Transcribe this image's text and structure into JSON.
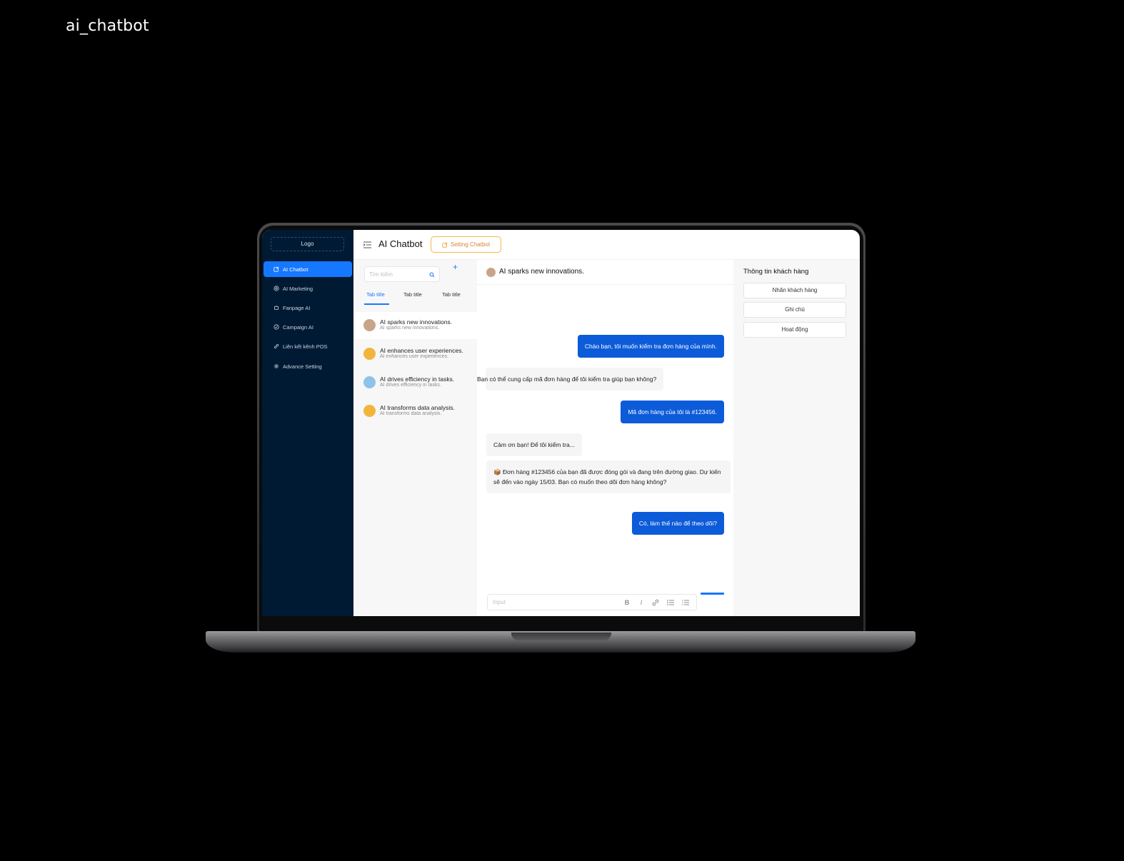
{
  "page_label": "ai_chatbot",
  "sidebar": {
    "logo": "Logo",
    "items": [
      {
        "label": "AI Chatbot",
        "icon": "edit-icon",
        "active": true
      },
      {
        "label": "AI Marketing",
        "icon": "target-icon",
        "active": false
      },
      {
        "label": "Fanpage AI",
        "icon": "puzzle-icon",
        "active": false
      },
      {
        "label": "Campaign AI",
        "icon": "check-circle-icon",
        "active": false
      },
      {
        "label": "Liên kết kênh POS",
        "icon": "link-icon",
        "active": false
      },
      {
        "label": "Advance Setting",
        "icon": "gear-icon",
        "active": false
      }
    ]
  },
  "header": {
    "title": "AI Chatbot",
    "setting_button": "Setting Chatbot"
  },
  "conversations": {
    "search_placeholder": "Tìm kiếm",
    "add_label": "+",
    "tabs": [
      "Tab title",
      "Tab title",
      "Tab title"
    ],
    "items": [
      {
        "title": "AI sparks new innovations.",
        "subtitle": "AI sparks new innovations.",
        "avatar_color": "#c9a48a"
      },
      {
        "title": "AI enhances user experiences.",
        "subtitle": "AI enhances user experiences.",
        "avatar_color": "#f2b53c"
      },
      {
        "title": "AI drives efficiency in tasks.",
        "subtitle": "AI drives efficiency in tasks.",
        "avatar_color": "#8fc2e8"
      },
      {
        "title": "AI transforms data analysis.",
        "subtitle": "AI transforms data analysis.",
        "avatar_color": "#f2b53c"
      }
    ]
  },
  "chat": {
    "title": "AI sparks new innovations.",
    "messages": [
      {
        "side": "out",
        "text": "Chào bạn, tôi muốn kiểm tra đơn hàng của mình."
      },
      {
        "side": "in",
        "text": "Bạn có thể cung cấp mã đơn hàng để tôi kiểm tra giúp bạn không?"
      },
      {
        "side": "out",
        "text": "Mã đơn hàng của tôi là #123456."
      },
      {
        "side": "in",
        "text": "Cảm ơn bạn! Để tôi kiểm tra..."
      },
      {
        "side": "in",
        "text": "📦 Đơn hàng #123456 của bạn đã được đóng gói và đang trên đường giao. Dự kiến sẽ đến vào ngày 15/03. Bạn có muốn theo dõi đơn hàng không?"
      },
      {
        "side": "out",
        "text": "Có, làm thế nào để theo dõi?"
      }
    ],
    "input_placeholder": "Input",
    "format_buttons": [
      "B",
      "I",
      "link",
      "bullets",
      "numbered"
    ]
  },
  "info_panel": {
    "title": "Thông tin khách hàng",
    "buttons": [
      "Nhãn khách hàng",
      "Ghi chú",
      "Hoạt động"
    ]
  },
  "colors": {
    "sidebar_bg": "#001a33",
    "accent": "#1677ff",
    "outgoing_bubble": "#0c5bd9",
    "setting_accent": "#f09a2a"
  }
}
